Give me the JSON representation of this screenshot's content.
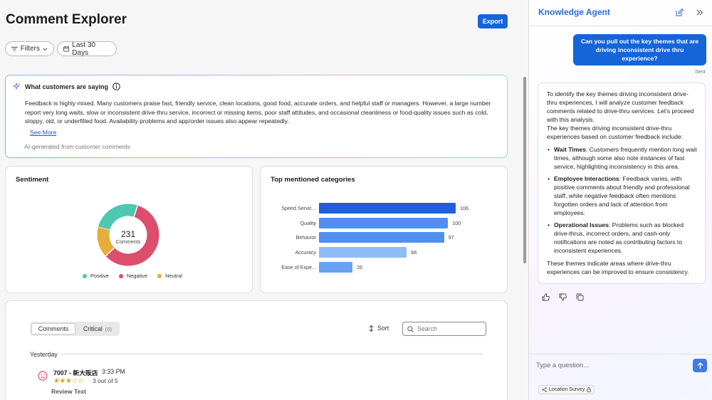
{
  "header": {
    "title": "Comment Explorer",
    "export_label": "Export"
  },
  "filters": {
    "filters_label": "Filters",
    "date_label": "Last 30 Days"
  },
  "summary": {
    "heading": "What customers are saying",
    "body": "Feedback is highly mixed. Many customers praise fast, friendly service, clean locations, good food, accurate orders, and helpful staff or managers. However, a large number report very long waits, slow or inconsistent drive-thru service, incorrect or missing items, poor staff attitudes, and occasional cleanliness or food-quality issues such as cold, sloppy, old, or underfilled food. Availability problems and app/order issues also appear repeatedly.",
    "see_more": "See More",
    "ai_note": "AI-generated from customer comments"
  },
  "sentiment": {
    "title": "Sentiment",
    "total": "231",
    "total_label": "Comments",
    "legend": [
      "Positive",
      "Negative",
      "Neutral"
    ],
    "colors": {
      "positive": "#4fc7b2",
      "negative": "#dd4d6c",
      "neutral": "#e6ad3a"
    }
  },
  "categories_card": {
    "title": "Top mentioned categories"
  },
  "chart_data": [
    {
      "type": "pie",
      "title": "Sentiment",
      "labels": [
        "Positive",
        "Negative",
        "Neutral"
      ],
      "values": [
        60,
        134,
        37
      ],
      "center_value": 231,
      "center_label": "Comments"
    },
    {
      "type": "bar",
      "orientation": "horizontal",
      "title": "Top mentioned categories",
      "categories": [
        "Speed Servic...",
        "Quality",
        "Behavior",
        "Accuracy",
        "Ease of Expe..."
      ],
      "values": [
        106,
        100,
        97,
        68,
        26
      ],
      "colors": [
        "#1f5fdc",
        "#4f8ff0",
        "#4f8ff0",
        "#8ebcf6",
        "#69a2f2"
      ],
      "xlim": [
        0,
        106
      ]
    }
  ],
  "comments": {
    "tabs": [
      {
        "label": "Comments"
      },
      {
        "label": "Critical",
        "count": "(0)"
      }
    ],
    "sort_label": "Sort",
    "search_placeholder": "Search",
    "group_label": "Yesterday",
    "items": [
      {
        "store": "7007 - 新大阪店",
        "time": "3:33 PM",
        "stars": "★★★☆☆",
        "rating_text": "3 out of 5",
        "review_label": "Review Text"
      }
    ]
  },
  "agent": {
    "title": "Knowledge Agent",
    "user_message": "Can you pull out the key themes that are driving inconsistent drive thru experience?",
    "sent_label": "Sent",
    "response_intro": "To identify the key themes driving inconsistent drive-thru experiences, I will analyze customer feedback comments related to drive-thru services. Let's proceed with this analysis.",
    "response_lead": "The key themes driving inconsistent drive-thru experiences based on customer feedback include:",
    "themes": [
      {
        "title": "Wait Times",
        "text": ": Customers frequently mention long wait times, although some also note instances of fast service, highlighting inconsistency in this area."
      },
      {
        "title": "Employee Interactions",
        "text": ": Feedback varies, with positive comments about friendly and professional staff, while negative feedback often mentions forgotten orders and lack of attention from employees."
      },
      {
        "title": "Operational Issues",
        "text": ": Problems such as blocked drive-thrus, incorrect orders, and cash-only notifications are noted as contributing factors to inconsistent experiences."
      }
    ],
    "response_outro": "These themes indicate areas where drive-thru experiences can be improved to ensure consistency.",
    "composer_placeholder": "Type a question...",
    "context_chip": "Location Survey"
  }
}
